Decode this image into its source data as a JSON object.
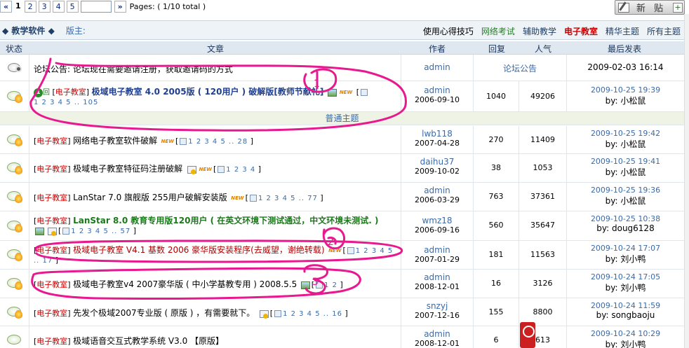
{
  "pager": {
    "prev": "«",
    "pages": [
      "1",
      "2",
      "3",
      "4",
      "5"
    ],
    "next": "»",
    "info": "Pages: ( 1/10 total )",
    "input_value": ""
  },
  "new_post": {
    "label": "新 贴",
    "plus": "+"
  },
  "forum": {
    "title": "◆ 教学软件 ◆",
    "moderator": "版主:",
    "links": [
      "使用心得技巧",
      "网络考试",
      "辅助教学",
      "电子教室",
      "精华主题",
      "所有主题"
    ]
  },
  "columns": {
    "status": "状态",
    "topic": "文章",
    "author": "作者",
    "replies": "回复",
    "views": "人气",
    "last": "最后发表"
  },
  "announcement": {
    "title": "论坛公告: 论坛现在需要邀请注册，获取邀请码的方式",
    "author": "admin",
    "type": "论坛公告",
    "last": "2009-02-03 16:14"
  },
  "sticky": {
    "badge": "1",
    "badge_suffix": "回",
    "category": "电子教室",
    "title": "极域电子教室 4.0 2005版 ( 120用户 )  破解版[教师节献礼]",
    "pages": "1 2 3 4 5 .. 105",
    "author": "admin",
    "date": "2006-09-10",
    "replies": "1040",
    "views": "49206",
    "last_date": "2009-10-25 19:39",
    "last_by": "by: 小松鼠"
  },
  "section_label": "普通主题",
  "threads": [
    {
      "category": "电子教室",
      "title": "网络电子教室软件破解",
      "style": "plain",
      "pages": "1 2 3 4 5 .. 28",
      "author": "lwb118",
      "date": "2007-04-28",
      "replies": "270",
      "views": "11409",
      "last_date": "2009-10-25 19:42",
      "last_by": "by: 小松鼠"
    },
    {
      "category": "电子教室",
      "title": "极域电子教室特征码注册破解",
      "style": "plain",
      "pages": "1 2 3 4",
      "author": "daihu37",
      "date": "2009-10-02",
      "replies": "38",
      "views": "1053",
      "last_date": "2009-10-25 19:41",
      "last_by": "by: 小松鼠"
    },
    {
      "category": "电子教室",
      "title": "LanStar 7.0 旗舰版 255用户破解安装版",
      "style": "plain",
      "pages": "1 2 3 4 5 .. 77",
      "author": "admin",
      "date": "2006-03-29",
      "replies": "763",
      "views": "37361",
      "last_date": "2009-10-25 19:36",
      "last_by": "by: 小松鼠"
    },
    {
      "category": "电子教室",
      "title": "LanStar 8.0 教育专用版120用户 ( 在英文环境下测试通过，中文环境未测试. )",
      "style": "green",
      "pages": "1 2 3 4 5 .. 57",
      "author": "wmz18",
      "date": "2006-09-16",
      "replies": "560",
      "views": "35647",
      "last_date": "2009-10-25 10:38",
      "last_by": "by: doug6128"
    },
    {
      "category": "电子教室",
      "title": "极域电子教室 V4.1 基数 2006 豪华版安装程序(去威望，谢绝转载)",
      "style": "red",
      "pages": "1 2 3 4 5 .. 17",
      "author": "admin",
      "date": "2007-01-29",
      "replies": "181",
      "views": "11563",
      "last_date": "2009-10-24 17:07",
      "last_by": "by: 刘小鸭"
    },
    {
      "category": "电子教室",
      "title": "极域电子教室v4 2007豪华版 ( 中小学基教专用 ) 2008.5.5",
      "style": "plain",
      "pages": "1 2",
      "author": "admin",
      "date": "2008-12-01",
      "replies": "16",
      "views": "3126",
      "last_date": "2009-10-24 17:05",
      "last_by": "by: 刘小鸭"
    },
    {
      "category": "电子教室",
      "title": "先发个极域2007专业版 ( 原版 ) ，有需要就下。",
      "style": "plain",
      "pages": "1 2 3 4 5 .. 16",
      "author": "snzyj",
      "date": "2007-12-16",
      "replies": "155",
      "views": "8800",
      "last_date": "2009-10-24 11:59",
      "last_by": "by: songbaoju"
    },
    {
      "category": "电子教室",
      "title": "极域语音交互式教学系统 V3.0 【原版】",
      "style": "plain",
      "pages": "",
      "author": "admin",
      "date": "2008-12-01",
      "replies": "6",
      "views": "613",
      "last_date": "2009-10-24 10:29",
      "last_by": "by: 刘小鸭"
    }
  ],
  "annotations": [
    "1",
    "2",
    "3"
  ],
  "colors": {
    "highlight": "#e8188f",
    "category": "#cc0000",
    "link": "#3a6aa8",
    "header_bg": "#dfe8f1"
  }
}
